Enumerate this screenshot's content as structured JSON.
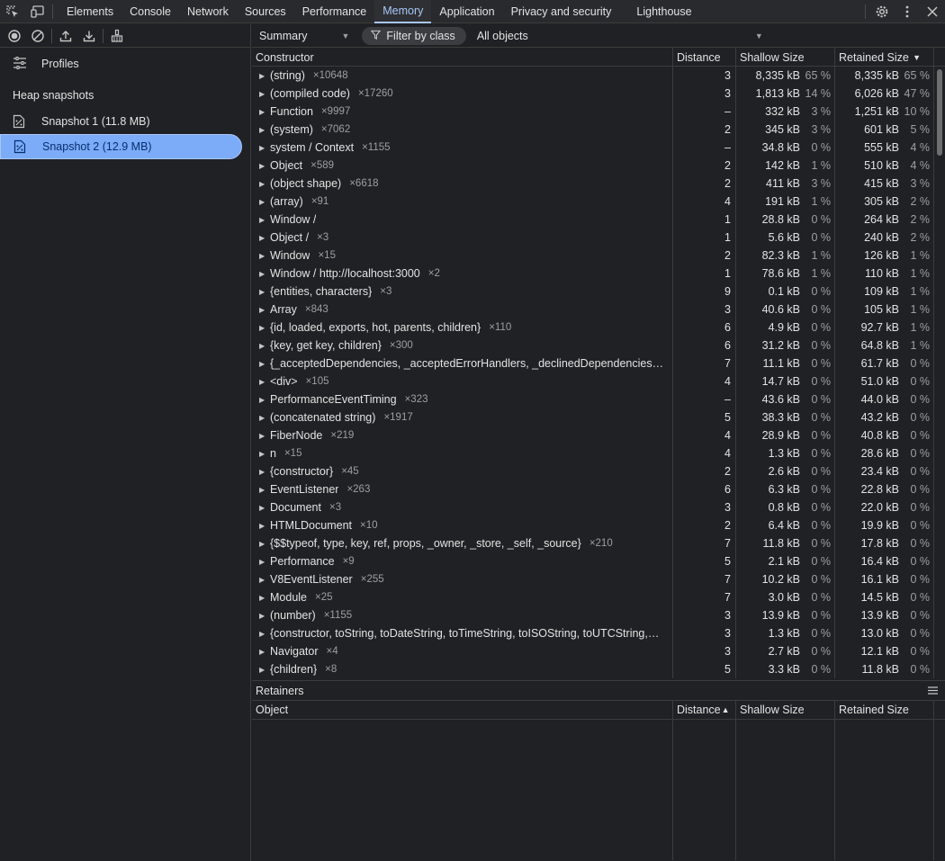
{
  "tabbar": {
    "tabs": [
      {
        "label": "Elements",
        "active": false
      },
      {
        "label": "Console",
        "active": false
      },
      {
        "label": "Network",
        "active": false
      },
      {
        "label": "Sources",
        "active": false
      },
      {
        "label": "Performance",
        "active": false
      },
      {
        "label": "Memory",
        "active": true
      },
      {
        "label": "Application",
        "active": false
      },
      {
        "label": "Privacy and security",
        "active": false
      },
      {
        "label": "Lighthouse",
        "active": false
      }
    ],
    "icons": [
      "inspect-element-icon",
      "device-toolbar-icon",
      "settings-icon",
      "more-options-icon",
      "close-icon"
    ]
  },
  "sidebar": {
    "toolbar_icons": [
      "record-icon",
      "clear-icon",
      "load-profile-icon",
      "save-profile-icon",
      "collect-garbage-icon"
    ],
    "profiles_label": "Profiles",
    "section_title": "Heap snapshots",
    "snapshots": [
      {
        "label": "Snapshot 1 (11.8 MB)",
        "selected": false
      },
      {
        "label": "Snapshot 2 (12.9 MB)",
        "selected": true
      }
    ]
  },
  "filterbar": {
    "view": "Summary",
    "filter_label": "Filter by class",
    "objects": "All objects"
  },
  "grid": {
    "headers": {
      "constructor": "Constructor",
      "distance": "Distance",
      "shallow": "Shallow Size",
      "retained": "Retained Size"
    },
    "rows": [
      {
        "name": "(string)",
        "count": "×10648",
        "distance": "3",
        "shallow": "8,335 kB",
        "shallow_pct": "65 %",
        "retained": "8,335 kB",
        "retained_pct": "65 %"
      },
      {
        "name": "(compiled code)",
        "count": "×17260",
        "distance": "3",
        "shallow": "1,813 kB",
        "shallow_pct": "14 %",
        "retained": "6,026 kB",
        "retained_pct": "47 %"
      },
      {
        "name": "Function",
        "count": "×9997",
        "distance": "–",
        "shallow": "332 kB",
        "shallow_pct": "3 %",
        "retained": "1,251 kB",
        "retained_pct": "10 %"
      },
      {
        "name": "(system)",
        "count": "×7062",
        "distance": "2",
        "shallow": "345 kB",
        "shallow_pct": "3 %",
        "retained": "601 kB",
        "retained_pct": "5 %"
      },
      {
        "name": "system / Context",
        "count": "×1155",
        "distance": "–",
        "shallow": "34.8 kB",
        "shallow_pct": "0 %",
        "retained": "555 kB",
        "retained_pct": "4 %"
      },
      {
        "name": "Object",
        "count": "×589",
        "distance": "2",
        "shallow": "142 kB",
        "shallow_pct": "1 %",
        "retained": "510 kB",
        "retained_pct": "4 %"
      },
      {
        "name": "(object shape)",
        "count": "×6618",
        "distance": "2",
        "shallow": "411 kB",
        "shallow_pct": "3 %",
        "retained": "415 kB",
        "retained_pct": "3 %"
      },
      {
        "name": "(array)",
        "count": "×91",
        "distance": "4",
        "shallow": "191 kB",
        "shallow_pct": "1 %",
        "retained": "305 kB",
        "retained_pct": "2 %"
      },
      {
        "name": "Window /",
        "count": "",
        "distance": "1",
        "shallow": "28.8 kB",
        "shallow_pct": "0 %",
        "retained": "264 kB",
        "retained_pct": "2 %"
      },
      {
        "name": "Object /",
        "count": "×3",
        "distance": "1",
        "shallow": "5.6 kB",
        "shallow_pct": "0 %",
        "retained": "240 kB",
        "retained_pct": "2 %"
      },
      {
        "name": "Window",
        "count": "×15",
        "distance": "2",
        "shallow": "82.3 kB",
        "shallow_pct": "1 %",
        "retained": "126 kB",
        "retained_pct": "1 %"
      },
      {
        "name": "Window / http://localhost:3000",
        "count": "×2",
        "distance": "1",
        "shallow": "78.6 kB",
        "shallow_pct": "1 %",
        "retained": "110 kB",
        "retained_pct": "1 %"
      },
      {
        "name": "{entities, characters}",
        "count": "×3",
        "distance": "9",
        "shallow": "0.1 kB",
        "shallow_pct": "0 %",
        "retained": "109 kB",
        "retained_pct": "1 %"
      },
      {
        "name": "Array",
        "count": "×843",
        "distance": "3",
        "shallow": "40.6 kB",
        "shallow_pct": "0 %",
        "retained": "105 kB",
        "retained_pct": "1 %"
      },
      {
        "name": "{id, loaded, exports, hot, parents, children}",
        "count": "×110",
        "distance": "6",
        "shallow": "4.9 kB",
        "shallow_pct": "0 %",
        "retained": "92.7 kB",
        "retained_pct": "1 %"
      },
      {
        "name": "{key, get key, children}",
        "count": "×300",
        "distance": "6",
        "shallow": "31.2 kB",
        "shallow_pct": "0 %",
        "retained": "64.8 kB",
        "retained_pct": "1 %"
      },
      {
        "name": "{_acceptedDependencies, _acceptedErrorHandlers, _declinedDependencies…",
        "count": "",
        "distance": "7",
        "shallow": "11.1 kB",
        "shallow_pct": "0 %",
        "retained": "61.7 kB",
        "retained_pct": "0 %"
      },
      {
        "name": "<div>",
        "count": "×105",
        "distance": "4",
        "shallow": "14.7 kB",
        "shallow_pct": "0 %",
        "retained": "51.0 kB",
        "retained_pct": "0 %"
      },
      {
        "name": "PerformanceEventTiming",
        "count": "×323",
        "distance": "–",
        "shallow": "43.6 kB",
        "shallow_pct": "0 %",
        "retained": "44.0 kB",
        "retained_pct": "0 %"
      },
      {
        "name": "(concatenated string)",
        "count": "×1917",
        "distance": "5",
        "shallow": "38.3 kB",
        "shallow_pct": "0 %",
        "retained": "43.2 kB",
        "retained_pct": "0 %"
      },
      {
        "name": "FiberNode",
        "count": "×219",
        "distance": "4",
        "shallow": "28.9 kB",
        "shallow_pct": "0 %",
        "retained": "40.8 kB",
        "retained_pct": "0 %"
      },
      {
        "name": "n",
        "count": "×15",
        "distance": "4",
        "shallow": "1.3 kB",
        "shallow_pct": "0 %",
        "retained": "28.6 kB",
        "retained_pct": "0 %"
      },
      {
        "name": "{constructor}",
        "count": "×45",
        "distance": "2",
        "shallow": "2.6 kB",
        "shallow_pct": "0 %",
        "retained": "23.4 kB",
        "retained_pct": "0 %"
      },
      {
        "name": "EventListener",
        "count": "×263",
        "distance": "6",
        "shallow": "6.3 kB",
        "shallow_pct": "0 %",
        "retained": "22.8 kB",
        "retained_pct": "0 %"
      },
      {
        "name": "Document",
        "count": "×3",
        "distance": "3",
        "shallow": "0.8 kB",
        "shallow_pct": "0 %",
        "retained": "22.0 kB",
        "retained_pct": "0 %"
      },
      {
        "name": "HTMLDocument",
        "count": "×10",
        "distance": "2",
        "shallow": "6.4 kB",
        "shallow_pct": "0 %",
        "retained": "19.9 kB",
        "retained_pct": "0 %"
      },
      {
        "name": "{$$typeof, type, key, ref, props, _owner, _store, _self, _source}",
        "count": "×210",
        "distance": "7",
        "shallow": "11.8 kB",
        "shallow_pct": "0 %",
        "retained": "17.8 kB",
        "retained_pct": "0 %"
      },
      {
        "name": "Performance",
        "count": "×9",
        "distance": "5",
        "shallow": "2.1 kB",
        "shallow_pct": "0 %",
        "retained": "16.4 kB",
        "retained_pct": "0 %"
      },
      {
        "name": "V8EventListener",
        "count": "×255",
        "distance": "7",
        "shallow": "10.2 kB",
        "shallow_pct": "0 %",
        "retained": "16.1 kB",
        "retained_pct": "0 %"
      },
      {
        "name": "Module",
        "count": "×25",
        "distance": "7",
        "shallow": "3.0 kB",
        "shallow_pct": "0 %",
        "retained": "14.5 kB",
        "retained_pct": "0 %"
      },
      {
        "name": "(number)",
        "count": "×1155",
        "distance": "3",
        "shallow": "13.9 kB",
        "shallow_pct": "0 %",
        "retained": "13.9 kB",
        "retained_pct": "0 %"
      },
      {
        "name": "{constructor, toString, toDateString, toTimeString, toISOString, toUTCString,…",
        "count": "",
        "distance": "3",
        "shallow": "1.3 kB",
        "shallow_pct": "0 %",
        "retained": "13.0 kB",
        "retained_pct": "0 %"
      },
      {
        "name": "Navigator",
        "count": "×4",
        "distance": "3",
        "shallow": "2.7 kB",
        "shallow_pct": "0 %",
        "retained": "12.1 kB",
        "retained_pct": "0 %"
      },
      {
        "name": "{children}",
        "count": "×8",
        "distance": "5",
        "shallow": "3.3 kB",
        "shallow_pct": "0 %",
        "retained": "11.8 kB",
        "retained_pct": "0 %"
      }
    ]
  },
  "retainers": {
    "title": "Retainers",
    "headers": {
      "object": "Object",
      "distance": "Distance",
      "shallow": "Shallow Size",
      "retained": "Retained Size"
    }
  }
}
